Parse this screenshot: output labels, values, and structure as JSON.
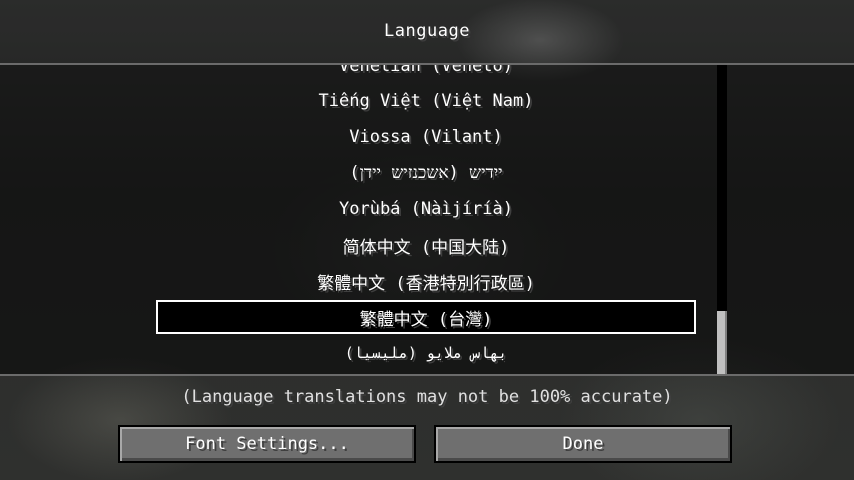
{
  "screen": {
    "title": "Language"
  },
  "languages": [
    {
      "label": "Venetian (Veneto)"
    },
    {
      "label": "Tiếng Việt (Việt Nam)"
    },
    {
      "label": "Viossa (Vilant)"
    },
    {
      "label": "ייִדיש (אשכנזיש יידן)"
    },
    {
      "label": "Yorùbá (Nàìjíríà)"
    },
    {
      "label": "简体中文 (中国大陆)"
    },
    {
      "label": "繁體中文 (香港特別行政區)"
    },
    {
      "label": "繁體中文 (台灣)"
    },
    {
      "label": "بهاس ملايو (مليسيا)"
    }
  ],
  "notice": "(Language translations may not be 100% accurate)",
  "buttons": {
    "font_settings": "Font Settings...",
    "done": "Done"
  }
}
